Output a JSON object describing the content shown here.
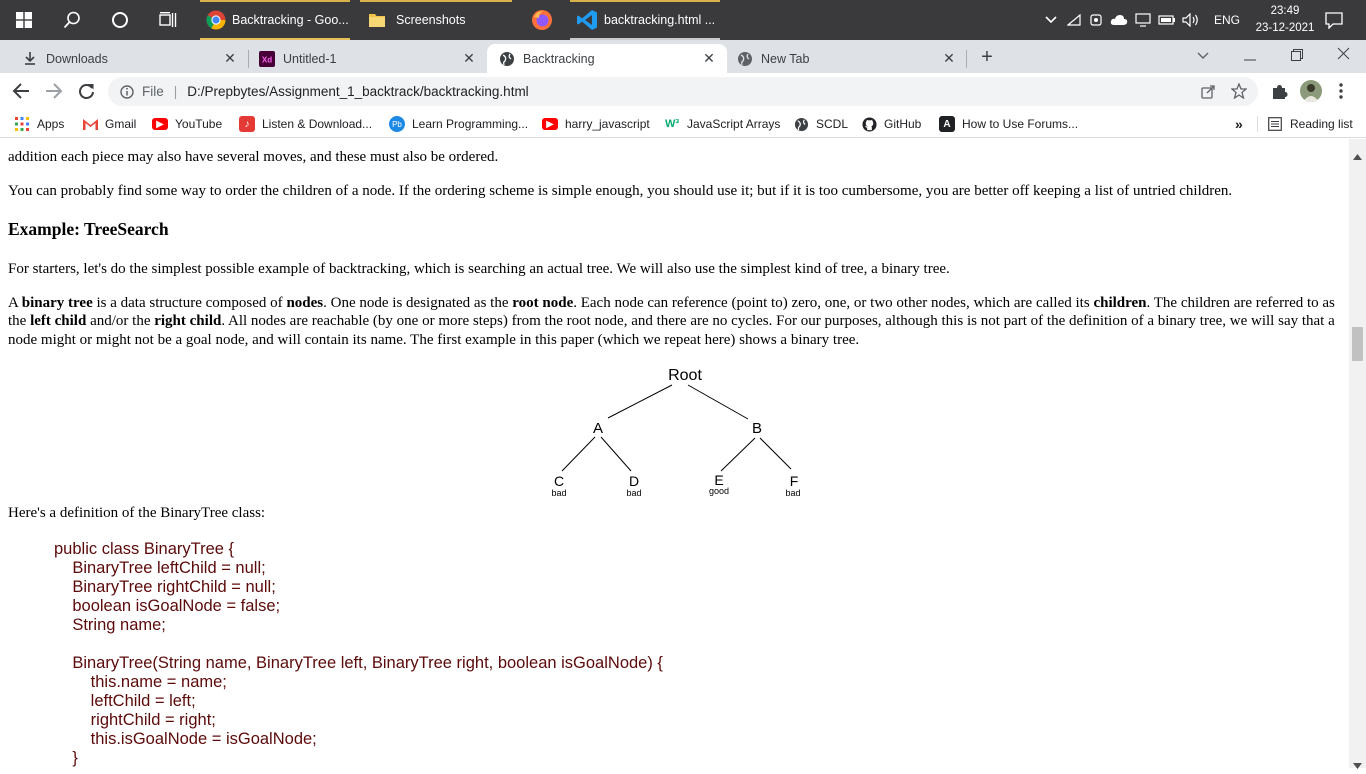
{
  "taskbar": {
    "apps": [
      {
        "label": "Backtracking - Goo..."
      },
      {
        "label": "Screenshots"
      },
      {
        "label": ""
      },
      {
        "label": "backtracking.html ..."
      }
    ],
    "language": "ENG",
    "time": "23:49",
    "date": "23-12-2021"
  },
  "tabs": [
    {
      "label": "Downloads"
    },
    {
      "label": "Untitled-1"
    },
    {
      "label": "Backtracking"
    },
    {
      "label": "New Tab"
    }
  ],
  "address": {
    "scheme_label": "File",
    "url": "D:/Prepbytes/Assignment_1_backtrack/backtracking.html"
  },
  "bookmarks": [
    {
      "label": "Apps"
    },
    {
      "label": "Gmail"
    },
    {
      "label": "YouTube"
    },
    {
      "label": "Listen & Download..."
    },
    {
      "label": "Learn Programming..."
    },
    {
      "label": "harry_javascript"
    },
    {
      "label": "JavaScript Arrays"
    },
    {
      "label": "SCDL"
    },
    {
      "label": "GitHub"
    },
    {
      "label": "How to Use Forums..."
    }
  ],
  "reading_list": "Reading list",
  "page": {
    "clipped_line": "addition each piece may also have several moves, and these must also be ordered.",
    "p_order": "You can probably find some way to order the children of a node. If the ordering scheme is simple enough, you should use it; but if it is too cumbersome, you are better off keeping a list of untried children.",
    "heading": "Example: TreeSearch",
    "p_starters": "For starters, let's do the simplest possible example of backtracking, which is searching an actual tree. We will also use the simplest kind of tree, a binary tree.",
    "p_binary": {
      "t1": "A ",
      "b1": "binary tree",
      "t2": " is a data structure composed of ",
      "b2": "nodes",
      "t3": ". One node is designated as the ",
      "b3": "root node",
      "t4": ". Each node can reference (point to) zero, one, or two other nodes, which are called its ",
      "b4": "children",
      "t5": ". The children are referred to as the ",
      "b5": "left child",
      "t6": " and/or the ",
      "b6": "right child",
      "t7": ". All nodes are reachable (by one or more steps) from the root node, and there are no cycles. For our purposes, although this is not part of the definition of a binary tree, we will say that a node might or might not be a goal node, and will contain its name. The first example in this paper (which we repeat here) shows a binary tree."
    },
    "tree": {
      "root": "Root",
      "a": "A",
      "b": "B",
      "c": "C",
      "c_tag": "bad",
      "d": "D",
      "d_tag": "bad",
      "e": "E",
      "e_tag": "good",
      "f": "F",
      "f_tag": "bad"
    },
    "p_def": "Here's a definition of the BinaryTree class:",
    "code": [
      "public class BinaryTree {",
      "    BinaryTree leftChild = null;",
      "    BinaryTree rightChild = null;",
      "    boolean isGoalNode = false;",
      "    String name;",
      "",
      "    BinaryTree(String name, BinaryTree left, BinaryTree right, boolean isGoalNode) {",
      "        this.name = name;",
      "        leftChild = left;",
      "        rightChild = right;",
      "        this.isGoalNode = isGoalNode;",
      "    }"
    ]
  }
}
